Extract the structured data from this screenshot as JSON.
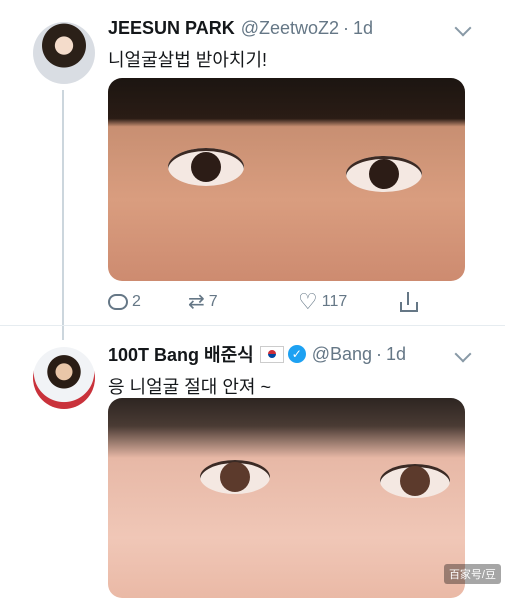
{
  "tweets": [
    {
      "display_name": "JEESUN PARK",
      "handle": "@ZeetwoZ2",
      "separator": "·",
      "time": "1d",
      "text": "니얼굴살법 받아치기!",
      "actions": {
        "replies": "2",
        "retweets": "7",
        "likes": "117"
      }
    },
    {
      "display_name": "100T Bang 배준식",
      "handle": "@Bang",
      "separator": "·",
      "time": "1d",
      "text": "응 니얼굴 절대 안져 ~"
    }
  ],
  "watermark": "百家号/豆",
  "icons": {
    "reply": "reply-icon",
    "retweet": "retweet-icon",
    "like": "heart-icon",
    "share": "share-icon",
    "verified": "verified-badge-icon",
    "flag": "korea-flag-icon"
  },
  "colors": {
    "accent": "#1da1f2",
    "secondary_text": "#657786",
    "thread_line": "#ccd6dd"
  }
}
